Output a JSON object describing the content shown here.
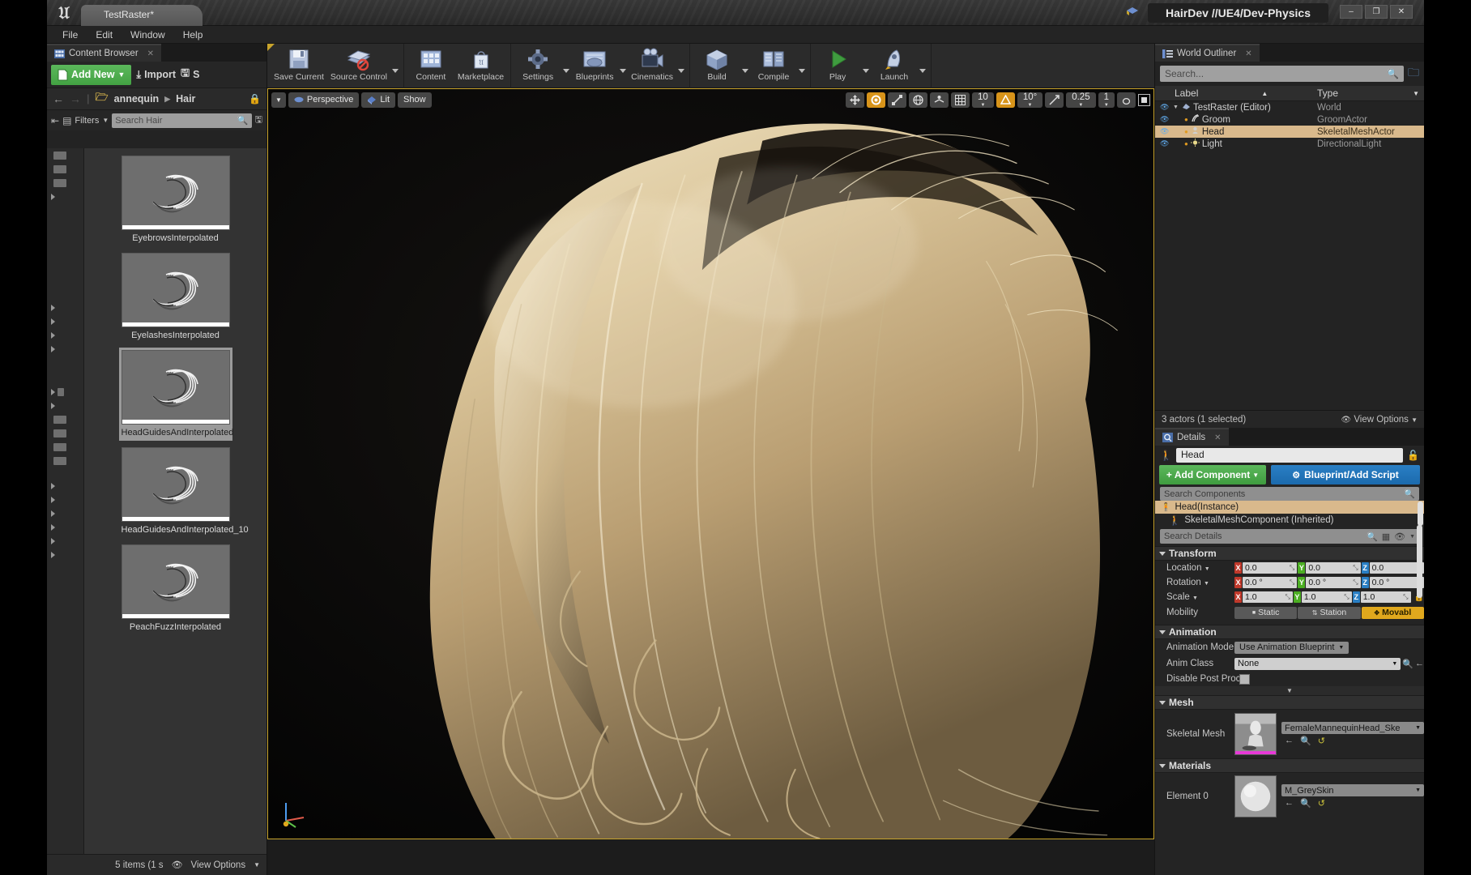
{
  "window": {
    "title": "HairDev //UE4/Dev-Physics",
    "project_tab": "TestRaster*",
    "minimize": "–",
    "maximize": "❐",
    "close": "✕"
  },
  "menu": {
    "items": [
      "File",
      "Edit",
      "Window",
      "Help"
    ]
  },
  "toolbar": {
    "groups": [
      {
        "buttons": [
          {
            "label": "Save Current",
            "icon": "save-icon",
            "caret": false
          },
          {
            "label": "Source Control",
            "icon": "source-control-icon",
            "caret": true
          }
        ]
      },
      {
        "buttons": [
          {
            "label": "Content",
            "icon": "content-icon",
            "caret": false
          },
          {
            "label": "Marketplace",
            "icon": "marketplace-icon",
            "caret": false
          }
        ]
      },
      {
        "buttons": [
          {
            "label": "Settings",
            "icon": "settings-gear-icon",
            "caret": true
          },
          {
            "label": "Blueprints",
            "icon": "blueprints-icon",
            "caret": true
          },
          {
            "label": "Cinematics",
            "icon": "cinematics-icon",
            "caret": true
          }
        ]
      },
      {
        "buttons": [
          {
            "label": "Build",
            "icon": "build-icon",
            "caret": true
          },
          {
            "label": "Compile",
            "icon": "compile-icon",
            "caret": true
          }
        ]
      },
      {
        "buttons": [
          {
            "label": "Play",
            "icon": "play-icon",
            "caret": true
          },
          {
            "label": "Launch",
            "icon": "launch-icon",
            "caret": true
          }
        ]
      }
    ]
  },
  "content_browser": {
    "tab_label": "Content Browser",
    "add_new": "Add New",
    "import": "Import",
    "save_all": "S",
    "breadcrumb": [
      "annequin",
      "Hair"
    ],
    "filters_label": "Filters",
    "search_placeholder": "Search Hair",
    "assets": [
      {
        "name": "EyebrowsInterpolated",
        "selected": false
      },
      {
        "name": "EyelashesInterpolated",
        "selected": false
      },
      {
        "name": "HeadGuidesAndInterpolated",
        "selected": true
      },
      {
        "name": "HeadGuidesAndInterpolated_10",
        "selected": false
      },
      {
        "name": "PeachFuzzInterpolated",
        "selected": false
      }
    ],
    "footer_status": "5 items (1 s",
    "view_options": "View Options"
  },
  "viewport": {
    "perspective": "Perspective",
    "lit": "Lit",
    "show": "Show",
    "grid_snap": "10",
    "angle_snap": "10°",
    "scale_snap": "0.25",
    "camera_speed": "1"
  },
  "outliner": {
    "tab_label": "World Outliner",
    "search_placeholder": "Search...",
    "columns": {
      "label": "Label",
      "type": "Type"
    },
    "rows": [
      {
        "label": "TestRaster (Editor)",
        "type": "World",
        "depth": 0,
        "selected": false,
        "icon": "world-icon"
      },
      {
        "label": "Groom",
        "type": "GroomActor",
        "depth": 1,
        "selected": false,
        "icon": "groom-icon"
      },
      {
        "label": "Head",
        "type": "SkeletalMeshActor",
        "depth": 1,
        "selected": true,
        "icon": "skeletal-mesh-icon"
      },
      {
        "label": "Light",
        "type": "DirectionalLight",
        "depth": 1,
        "selected": false,
        "icon": "light-icon"
      }
    ],
    "footer_status": "3 actors (1 selected)",
    "view_options": "View Options"
  },
  "details": {
    "tab_label": "Details",
    "actor_name": "Head",
    "add_component": "Add Component",
    "blueprint_add_script": "Blueprint/Add Script",
    "search_components_placeholder": "Search Components",
    "components": [
      {
        "label": "Head(Instance)",
        "selected": true
      },
      {
        "label": "SkeletalMeshComponent (Inherited)",
        "selected": false
      }
    ],
    "search_details_placeholder": "Search Details",
    "sections": {
      "transform": {
        "title": "Transform",
        "location": {
          "label": "Location",
          "x": "0.0",
          "y": "0.0",
          "z": "0.0"
        },
        "rotation": {
          "label": "Rotation",
          "x": "0.0 °",
          "y": "0.0 °",
          "z": "0.0 °"
        },
        "scale": {
          "label": "Scale",
          "x": "1.0",
          "y": "1.0",
          "z": "1.0"
        },
        "mobility": {
          "label": "Mobility",
          "options": [
            "Static",
            "Station",
            "Movabl"
          ],
          "selected": "Movabl"
        }
      },
      "animation": {
        "title": "Animation",
        "animation_mode": {
          "label": "Animation Mode",
          "value": "Use Animation Blueprint"
        },
        "anim_class": {
          "label": "Anim Class",
          "value": "None"
        },
        "disable_post_process": {
          "label": "Disable Post Process B",
          "checked": false
        }
      },
      "mesh": {
        "title": "Mesh",
        "skeletal_mesh": {
          "label": "Skeletal Mesh",
          "value": "FemaleMannequinHead_Ske"
        }
      },
      "materials": {
        "title": "Materials",
        "element_0": {
          "label": "Element 0",
          "value": "M_GreySkin"
        }
      }
    }
  },
  "colors": {
    "accent_yellow": "#c8a42c",
    "green": "#4fa94f",
    "blue": "#2a7fc4",
    "selection": "#d9b98c",
    "orange": "#e0a81d"
  }
}
